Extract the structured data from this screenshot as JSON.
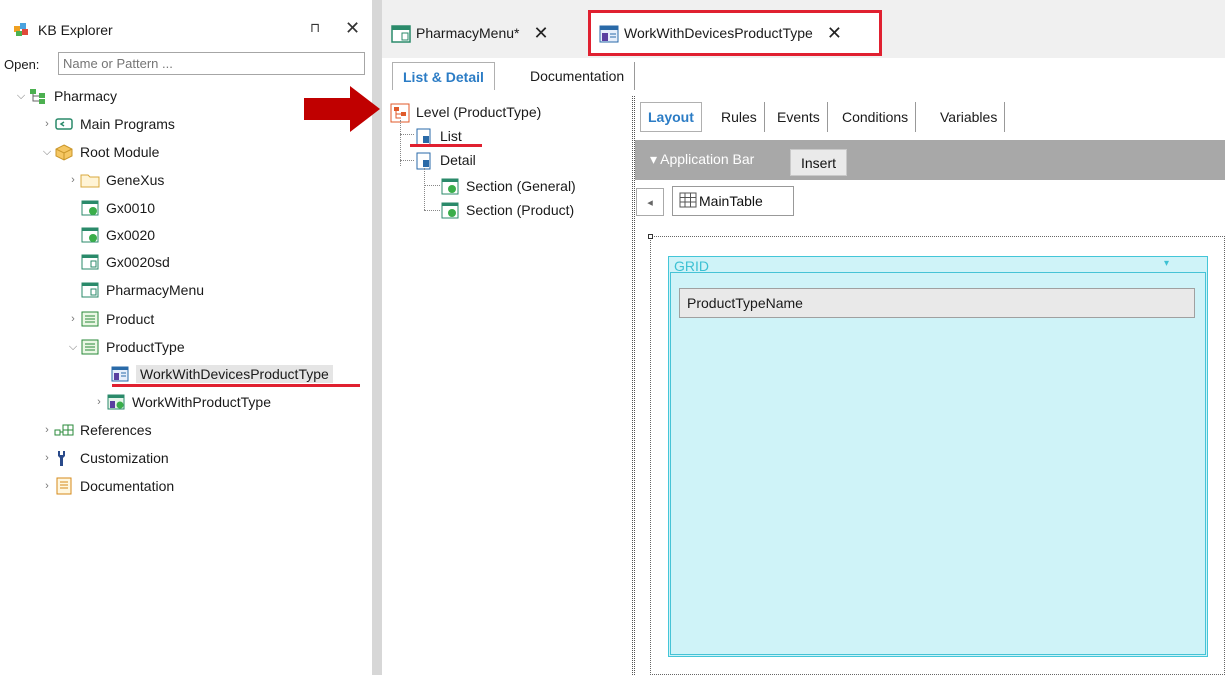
{
  "colors": {
    "accent_blue": "#2b7cc5",
    "highlight_red": "#e02030",
    "arrow_red": "#c00000",
    "grid_cyan": "#cff3f8",
    "grid_border": "#44c6d8",
    "appbar_gray": "#a8a8a8"
  },
  "kb_explorer": {
    "title": "KB Explorer",
    "pin_glyph": "⊓",
    "close_glyph": "✕",
    "open_label": "Open:",
    "search_placeholder": "Name or Pattern ...",
    "tree": [
      {
        "label": "Pharmacy",
        "icon": "kb-root-icon",
        "expanded": true
      },
      {
        "label": "Main Programs",
        "icon": "main-programs-icon",
        "expanded": false
      },
      {
        "label": "Root Module",
        "icon": "module-icon",
        "expanded": true
      },
      {
        "label": "GeneXus",
        "icon": "folder-icon",
        "expanded": false
      },
      {
        "label": "Gx0010",
        "icon": "web-panel-icon"
      },
      {
        "label": "Gx0020",
        "icon": "web-panel-icon"
      },
      {
        "label": "Gx0020sd",
        "icon": "panel-icon"
      },
      {
        "label": "PharmacyMenu",
        "icon": "panel-icon"
      },
      {
        "label": "Product",
        "icon": "transaction-icon",
        "expanded": false
      },
      {
        "label": "ProductType",
        "icon": "transaction-icon",
        "expanded": true
      },
      {
        "label": "WorkWithDevicesProductType",
        "icon": "work-with-devices-icon",
        "selected": true
      },
      {
        "label": "WorkWithProductType",
        "icon": "work-with-icon",
        "expanded": false
      },
      {
        "label": "References",
        "icon": "references-icon",
        "expanded": false
      },
      {
        "label": "Customization",
        "icon": "customization-icon",
        "expanded": false
      },
      {
        "label": "Documentation",
        "icon": "documentation-icon",
        "expanded": false
      }
    ]
  },
  "editor": {
    "tabs": [
      {
        "label": "PharmacyMenu*",
        "close": "✕"
      },
      {
        "label": "WorkWithDevicesProductType",
        "close": "✕",
        "active": true
      }
    ],
    "subtabs": [
      "List & Detail",
      "Documentation"
    ],
    "level_tree": {
      "level": "Level (ProductType)",
      "list": "List",
      "detail": "Detail",
      "sections": [
        "Section (General)",
        "Section (Product)"
      ]
    },
    "layout_tabs": [
      "Layout",
      "Rules",
      "Events",
      "Conditions",
      "Variables"
    ],
    "application_bar": {
      "label": "▾ Application Bar",
      "insert": "Insert"
    },
    "back_glyph": "◂",
    "main_table": "MainTable",
    "grid": {
      "label": "GRID",
      "dropdown": "▾",
      "field": "ProductTypeName"
    }
  }
}
